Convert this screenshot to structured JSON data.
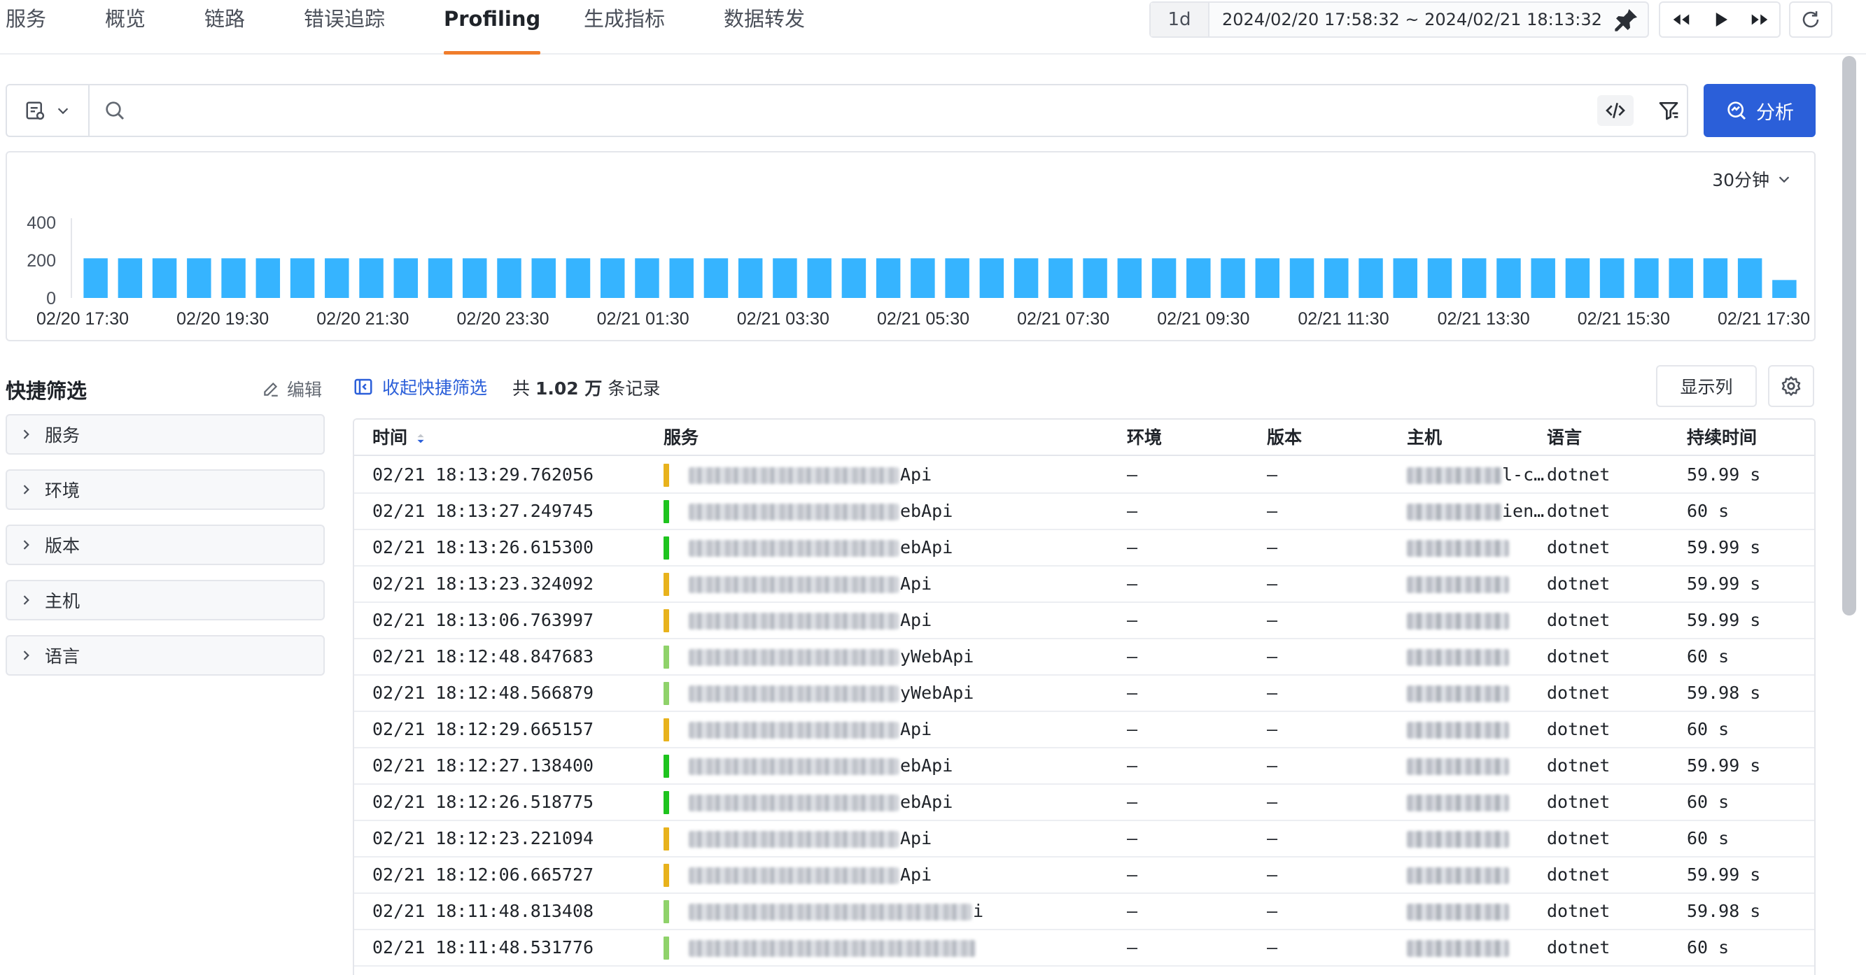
{
  "tabs": [
    {
      "label": "服务",
      "active": false
    },
    {
      "label": "概览",
      "active": false
    },
    {
      "label": "链路",
      "active": false
    },
    {
      "label": "错误追踪",
      "active": false
    },
    {
      "label": "Profiling",
      "active": true
    },
    {
      "label": "生成指标",
      "active": false
    },
    {
      "label": "数据转发",
      "active": false
    }
  ],
  "time_range": {
    "preset": "1d",
    "text": "2024/02/20 17:58:32 ~ 2024/02/21 18:13:32"
  },
  "search": {
    "placeholder": "",
    "analyze_label": "分析"
  },
  "colors": {
    "accent": "#2b5fd9",
    "tab_active_underline": "#f07d2c",
    "bar": "#36b4ff"
  },
  "chart_data": {
    "type": "bar",
    "interval_label": "30分钟",
    "y_ticks": [
      0,
      200,
      400
    ],
    "ylim": [
      0,
      400
    ],
    "x_tick_labels": [
      "02/20 17:30",
      "02/20 19:30",
      "02/20 21:30",
      "02/20 23:30",
      "02/21 01:30",
      "02/21 03:30",
      "02/21 05:30",
      "02/21 07:30",
      "02/21 09:30",
      "02/21 11:30",
      "02/21 13:30",
      "02/21 15:30",
      "02/21 17:30"
    ],
    "values": [
      210,
      210,
      210,
      210,
      210,
      210,
      210,
      210,
      210,
      210,
      210,
      210,
      210,
      210,
      210,
      210,
      210,
      210,
      210,
      210,
      210,
      210,
      210,
      210,
      210,
      210,
      210,
      210,
      210,
      210,
      210,
      210,
      210,
      210,
      210,
      210,
      210,
      210,
      210,
      210,
      210,
      210,
      210,
      210,
      210,
      210,
      210,
      210,
      210,
      95
    ]
  },
  "quick_filter": {
    "title": "快捷筛选",
    "edit_label": "编辑",
    "items": [
      "服务",
      "环境",
      "版本",
      "主机",
      "语言"
    ]
  },
  "toolbar": {
    "collapse_label": "收起快捷筛选",
    "count_prefix": "共",
    "count_value": "1.02 万",
    "count_suffix": "条记录",
    "show_columns_label": "显示列"
  },
  "table": {
    "columns": [
      "时间",
      "服务",
      "环境",
      "版本",
      "主机",
      "语言",
      "持续时间"
    ],
    "rows": [
      {
        "time": "02/21 18:13:29.762056",
        "service_suffix": "Api",
        "service_color": "#e8b21c",
        "env": "–",
        "version": "–",
        "host_suffix": "l-c…",
        "lang": "dotnet",
        "duration": "59.99 s"
      },
      {
        "time": "02/21 18:13:27.249745",
        "service_suffix": "ebApi",
        "service_color": "#1ec41e",
        "env": "–",
        "version": "–",
        "host_suffix": "ien…",
        "lang": "dotnet",
        "duration": "60 s"
      },
      {
        "time": "02/21 18:13:26.615300",
        "service_suffix": "ebApi",
        "service_color": "#1ec41e",
        "env": "–",
        "version": "–",
        "host_suffix": "",
        "lang": "dotnet",
        "duration": "59.99 s"
      },
      {
        "time": "02/21 18:13:23.324092",
        "service_suffix": "Api",
        "service_color": "#e8b21c",
        "env": "–",
        "version": "–",
        "host_suffix": "",
        "lang": "dotnet",
        "duration": "59.99 s"
      },
      {
        "time": "02/21 18:13:06.763997",
        "service_suffix": "Api",
        "service_color": "#e8b21c",
        "env": "–",
        "version": "–",
        "host_suffix": "",
        "lang": "dotnet",
        "duration": "59.99 s"
      },
      {
        "time": "02/21 18:12:48.847683",
        "service_suffix": "yWebApi",
        "service_color": "#8fd26a",
        "env": "–",
        "version": "–",
        "host_suffix": "",
        "lang": "dotnet",
        "duration": "60 s"
      },
      {
        "time": "02/21 18:12:48.566879",
        "service_suffix": "yWebApi",
        "service_color": "#8fd26a",
        "env": "–",
        "version": "–",
        "host_suffix": "",
        "lang": "dotnet",
        "duration": "59.98 s"
      },
      {
        "time": "02/21 18:12:29.665157",
        "service_suffix": "Api",
        "service_color": "#e8b21c",
        "env": "–",
        "version": "–",
        "host_suffix": "",
        "lang": "dotnet",
        "duration": "60 s"
      },
      {
        "time": "02/21 18:12:27.138400",
        "service_suffix": "ebApi",
        "service_color": "#1ec41e",
        "env": "–",
        "version": "–",
        "host_suffix": "",
        "lang": "dotnet",
        "duration": "59.99 s"
      },
      {
        "time": "02/21 18:12:26.518775",
        "service_suffix": "ebApi",
        "service_color": "#1ec41e",
        "env": "–",
        "version": "–",
        "host_suffix": "",
        "lang": "dotnet",
        "duration": "60 s"
      },
      {
        "time": "02/21 18:12:23.221094",
        "service_suffix": "Api",
        "service_color": "#e8b21c",
        "env": "–",
        "version": "–",
        "host_suffix": "",
        "lang": "dotnet",
        "duration": "60 s"
      },
      {
        "time": "02/21 18:12:06.665727",
        "service_suffix": "Api",
        "service_color": "#e8b21c",
        "env": "–",
        "version": "–",
        "host_suffix": "",
        "lang": "dotnet",
        "duration": "59.99 s"
      },
      {
        "time": "02/21 18:11:48.813408",
        "service_suffix": "i",
        "service_color": "#8fd26a",
        "env": "–",
        "version": "–",
        "host_suffix": "",
        "lang": "dotnet",
        "duration": "59.98 s"
      },
      {
        "time": "02/21 18:11:48.531776",
        "service_suffix": "",
        "service_color": "#8fd26a",
        "env": "–",
        "version": "–",
        "host_suffix": "",
        "lang": "dotnet",
        "duration": "60 s"
      }
    ]
  }
}
